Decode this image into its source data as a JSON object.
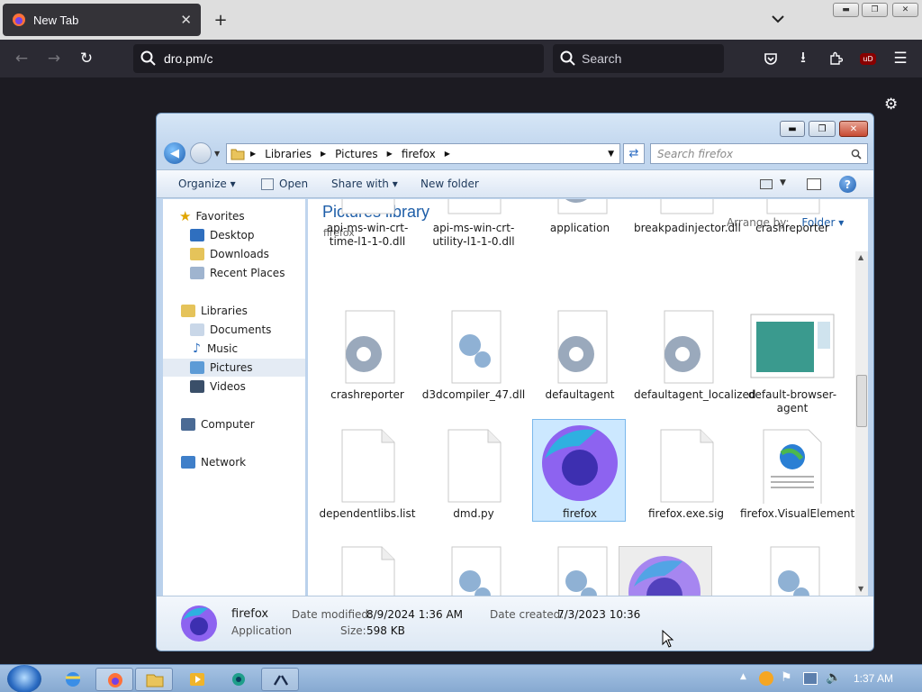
{
  "browser": {
    "tab_title": "New Tab",
    "tab_close": "✕",
    "new_tab": "+",
    "tabs_menu": "⌄",
    "url": "dro.pm/c",
    "search_placeholder": "Search",
    "ublock_label": "uD"
  },
  "explorer": {
    "breadcrumb": [
      "Libraries",
      "Pictures",
      "firefox"
    ],
    "search_placeholder": "Search firefox",
    "commands": {
      "organize": "Organize",
      "open": "Open",
      "share": "Share with",
      "new_folder": "New folder"
    },
    "nav": {
      "favorites": "Favorites",
      "desktop": "Desktop",
      "downloads": "Downloads",
      "recent": "Recent Places",
      "libraries": "Libraries",
      "documents": "Documents",
      "music": "Music",
      "pictures": "Pictures",
      "videos": "Videos",
      "computer": "Computer",
      "network": "Network"
    },
    "header": "Pictures library",
    "subheader": "firefox",
    "arrange_by": "Arrange by:",
    "arrange_value": "Folder",
    "files": [
      {
        "name": "api-ms-win-crt-time-l1-1-0.dll",
        "icon": "blank"
      },
      {
        "name": "api-ms-win-crt-utility-l1-1-0.dll",
        "icon": "blank"
      },
      {
        "name": "application",
        "icon": "gear"
      },
      {
        "name": "breakpadinjector.dll",
        "icon": "blank"
      },
      {
        "name": "crashreporter",
        "icon": "blank"
      },
      {
        "name": "crashreporter",
        "icon": "gear"
      },
      {
        "name": "d3dcompiler_47.dll",
        "icon": "gear-small"
      },
      {
        "name": "defaultagent",
        "icon": "gear"
      },
      {
        "name": "defaultagent_localized",
        "icon": "gear"
      },
      {
        "name": "default-browser-agent",
        "icon": "window"
      },
      {
        "name": "dependentlibs.list",
        "icon": "blank"
      },
      {
        "name": "dmd.py",
        "icon": "blank"
      },
      {
        "name": "firefox",
        "icon": "firefox"
      },
      {
        "name": "firefox.exe.sig",
        "icon": "blank"
      },
      {
        "name": "firefox.VisualElementsManifest",
        "icon": "xml"
      }
    ],
    "details": {
      "name": "firefox",
      "type": "Application",
      "modified_label": "Date modified:",
      "modified": "8/9/2024 1:36 AM",
      "created_label": "Date created:",
      "created": "7/3/2023 10:36",
      "size_label": "Size:",
      "size": "598 KB"
    }
  },
  "taskbar": {
    "clock": "1:37 AM"
  }
}
